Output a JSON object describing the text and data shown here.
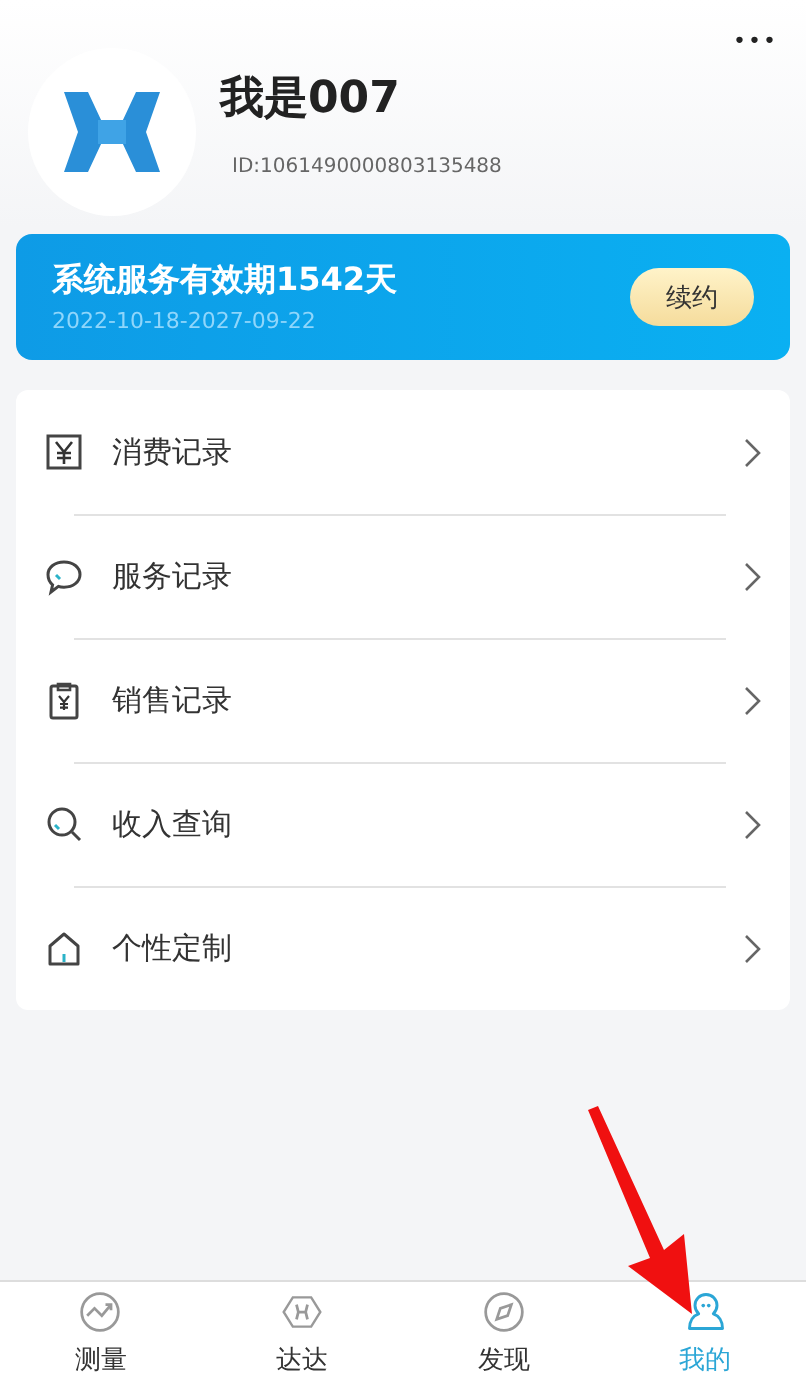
{
  "profile": {
    "name": "我是007",
    "id": "ID:1061490000803135488",
    "more": "•••"
  },
  "banner": {
    "title": "系统服务有效期1542天",
    "dates": "2022-10-18-2027-09-22",
    "button": "续约"
  },
  "menu": [
    {
      "kind": "yuan",
      "label": "消费记录"
    },
    {
      "kind": "chat",
      "label": "服务记录"
    },
    {
      "kind": "clipboard",
      "label": "销售记录"
    },
    {
      "kind": "search",
      "label": "收入查询"
    },
    {
      "kind": "house",
      "label": "个性定制"
    }
  ],
  "tabs": [
    {
      "kind": "chart",
      "label": "测量",
      "selected": false
    },
    {
      "kind": "hex",
      "label": "达达",
      "selected": false
    },
    {
      "kind": "compass",
      "label": "发现",
      "selected": false
    },
    {
      "kind": "person",
      "label": "我的",
      "selected": true
    }
  ]
}
